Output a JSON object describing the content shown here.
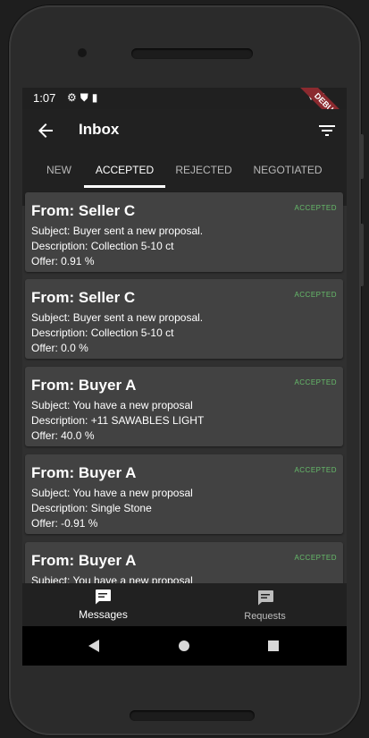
{
  "status_bar": {
    "time": "1:07",
    "debug_banner": "DEBUG"
  },
  "app_bar": {
    "title": "Inbox"
  },
  "tabs": [
    {
      "label": "NEW",
      "active": false
    },
    {
      "label": "ACCEPTED",
      "active": true
    },
    {
      "label": "REJECTED",
      "active": false
    },
    {
      "label": "NEGOTIATED",
      "active": false
    }
  ],
  "messages": [
    {
      "from": "From: Seller C",
      "status": "ACCEPTED",
      "subject": "Subject: Buyer sent a new proposal.",
      "description": "Description: Collection 5-10 ct",
      "offer": "Offer: 0.91 %"
    },
    {
      "from": "From: Seller C",
      "status": "ACCEPTED",
      "subject": "Subject: Buyer sent a new proposal.",
      "description": "Description: Collection 5-10 ct",
      "offer": "Offer: 0.0 %"
    },
    {
      "from": "From: Buyer A",
      "status": "ACCEPTED",
      "subject": "Subject: You have a new proposal",
      "description": "Description: +11 SAWABLES LIGHT",
      "offer": "Offer: 40.0 %"
    },
    {
      "from": "From: Buyer A",
      "status": "ACCEPTED",
      "subject": "Subject: You have a new proposal",
      "description": "Description: Single Stone",
      "offer": "Offer: -0.91 %"
    },
    {
      "from": "From: Buyer A",
      "status": "ACCEPTED",
      "subject": "Subject: You have a new proposal",
      "description": "",
      "offer": ""
    }
  ],
  "bottom_nav": [
    {
      "label": "Messages",
      "icon": "message-icon",
      "active": true
    },
    {
      "label": "Requests",
      "icon": "message-icon",
      "active": false
    }
  ],
  "colors": {
    "accent": "#66bb6a",
    "app_bar": "#212121",
    "card": "#424242",
    "background": "#303030"
  }
}
